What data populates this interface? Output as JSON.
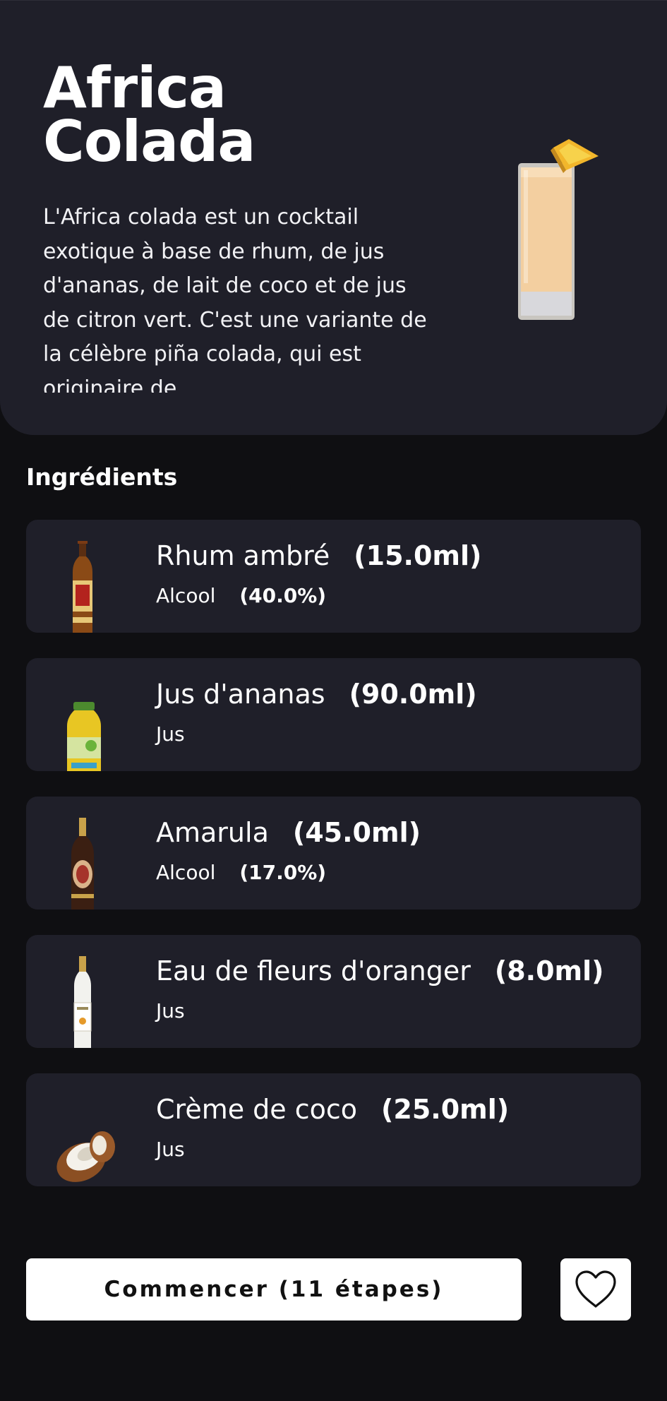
{
  "recipe": {
    "title": "Africa Colada",
    "description": "L'Africa colada est un cocktail exotique à base de rhum, de jus d'ananas, de lait de coco et de jus de citron vert. C'est une variante de la célèbre piña colada, qui est originaire de"
  },
  "ingredients_section": {
    "title": "Ingrédients"
  },
  "ingredients": [
    {
      "name": "Rhum ambré",
      "quantity": "(15.0ml)",
      "category": "Alcool",
      "abv": "(40.0%)",
      "icon": "rum-bottle-icon"
    },
    {
      "name": "Jus d'ananas",
      "quantity": "(90.0ml)",
      "category": "Jus",
      "abv": "",
      "icon": "pineapple-juice-bottle-icon"
    },
    {
      "name": "Amarula",
      "quantity": "(45.0ml)",
      "category": "Alcool",
      "abv": "(17.0%)",
      "icon": "amarula-bottle-icon"
    },
    {
      "name": "Eau de fleurs d'oranger",
      "quantity": "(8.0ml)",
      "category": "Jus",
      "abv": "",
      "icon": "orange-blossom-water-bottle-icon"
    },
    {
      "name": "Crème de coco",
      "quantity": "(25.0ml)",
      "category": "Jus",
      "abv": "",
      "icon": "coconut-icon"
    }
  ],
  "actions": {
    "start_label": "Commencer (11 étapes)",
    "favorite_icon": "heart-icon"
  },
  "colors": {
    "background": "#0f0f12",
    "card": "#1f1f29",
    "text": "#ffffff",
    "button": "#ffffff"
  }
}
